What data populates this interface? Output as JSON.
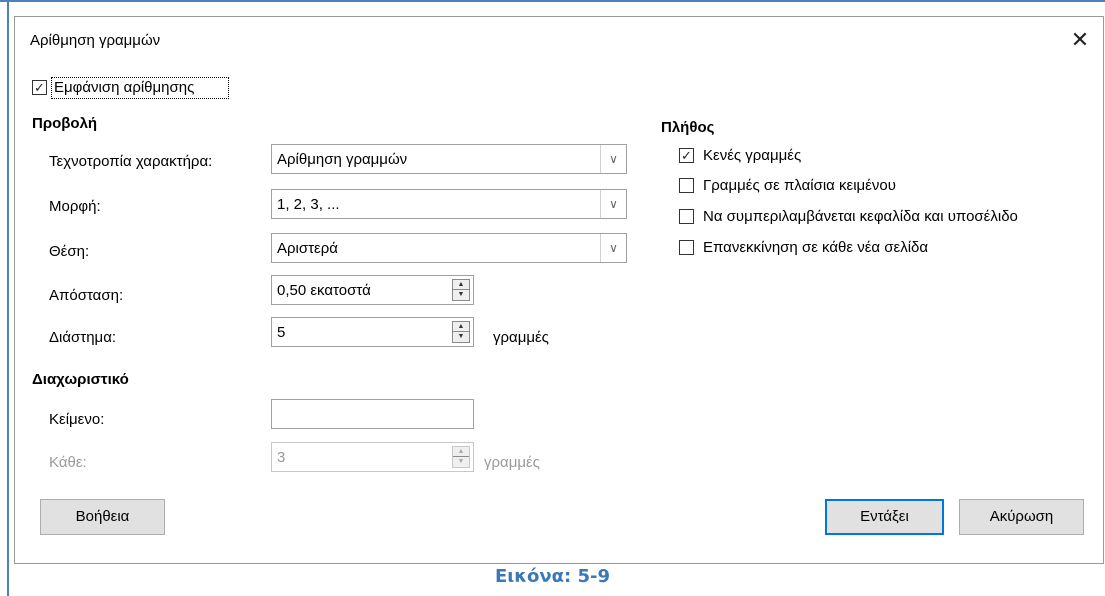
{
  "dialog": {
    "title": "Αρίθμηση γραμμών",
    "close_symbol": "✕",
    "show_numbering": {
      "label": "Εμφάνιση αρίθμησης",
      "checked": true
    }
  },
  "view": {
    "heading": "Προβολή",
    "character_style": {
      "label": "Τεχνοτροπία χαρακτήρα:",
      "value": "Αρίθμηση γραμμών"
    },
    "format": {
      "label": "Μορφή:",
      "value": "1, 2, 3, ..."
    },
    "position": {
      "label": "Θέση:",
      "value": "Αριστερά"
    },
    "spacing": {
      "label": "Απόσταση:",
      "value": "0,50 εκατοστά"
    },
    "interval": {
      "label": "Διάστημα:",
      "value": "5",
      "unit": "γραμμές"
    }
  },
  "separator": {
    "heading": "Διαχωριστικό",
    "text": {
      "label": "Κείμενο:",
      "value": ""
    },
    "every": {
      "label": "Κάθε:",
      "value": "3",
      "unit": "γραμμές"
    }
  },
  "count": {
    "heading": "Πλήθος",
    "options": [
      {
        "label": "Κενές γραμμές",
        "checked": true
      },
      {
        "label": "Γραμμές σε πλαίσια κειμένου",
        "checked": false
      },
      {
        "label": "Να συμπεριλαμβάνεται κεφαλίδα και υποσέλιδο",
        "checked": false
      },
      {
        "label": "Επανεκκίνηση σε κάθε νέα σελίδα",
        "checked": false
      }
    ]
  },
  "buttons": {
    "help": "Βοήθεια",
    "ok": "Εντάξει",
    "cancel": "Ακύρωση"
  },
  "icons": {
    "dropdown": "chevron-down-icon",
    "spin_up": "triangle-up-icon",
    "spin_down": "triangle-down-icon",
    "check": "checkmark-icon"
  },
  "caption": "Εικόνα: 5-9"
}
